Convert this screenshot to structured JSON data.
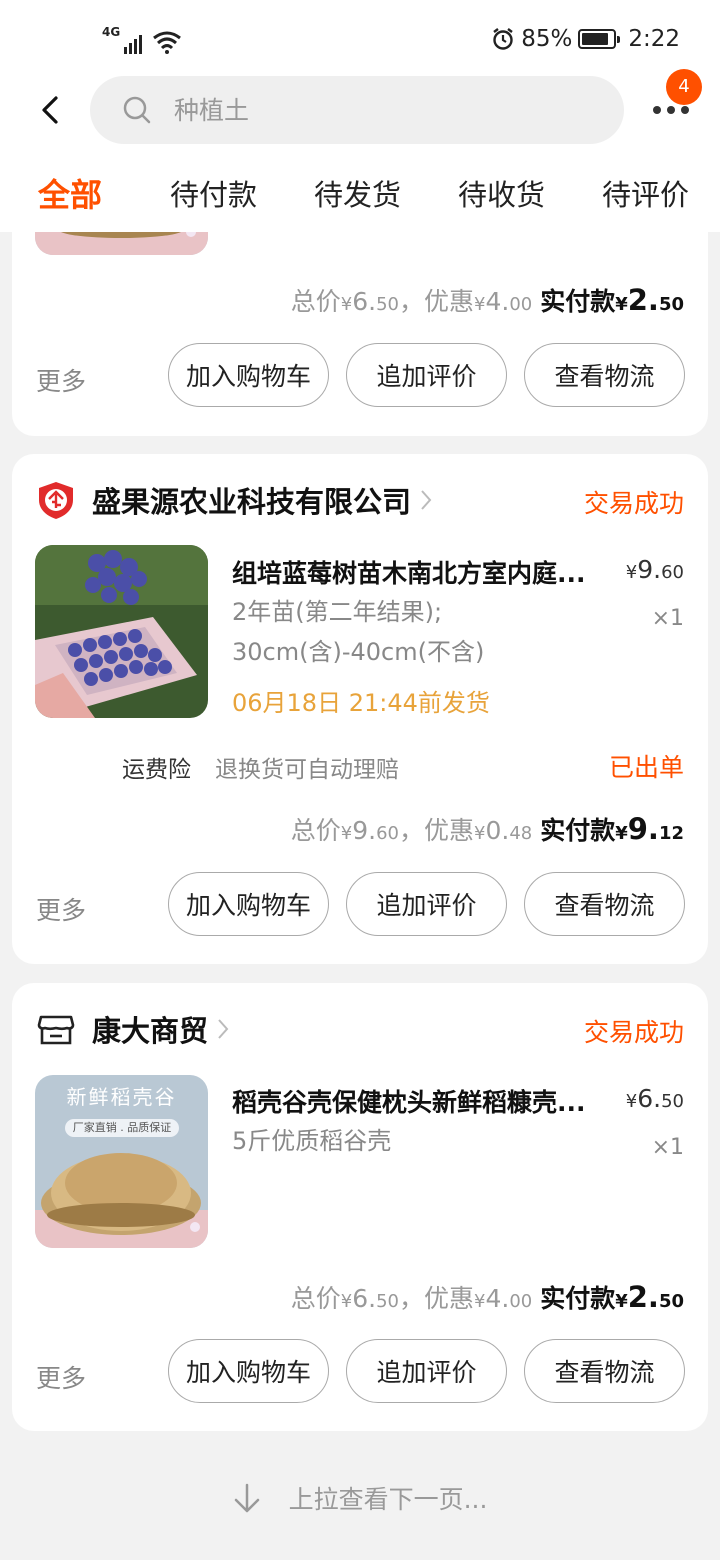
{
  "status_bar": {
    "network": "4G",
    "battery": "85%",
    "battery_level": 0.85,
    "time": "2:22"
  },
  "search": {
    "placeholder": "种植土",
    "badge_count": "4"
  },
  "tabs": [
    {
      "label": "全部",
      "active": true
    },
    {
      "label": "待付款",
      "active": false
    },
    {
      "label": "待发货",
      "active": false
    },
    {
      "label": "待收货",
      "active": false
    },
    {
      "label": "待评价",
      "active": false
    }
  ],
  "orders": [
    {
      "summary": {
        "total_label": "总价",
        "total_int": "6.",
        "total_dec": "50",
        "discount_label": "优惠",
        "discount_int": "4.",
        "discount_dec": "00",
        "paid_label": "实付款",
        "paid_int": "2.",
        "paid_dec": "50"
      },
      "actions": {
        "more": "更多",
        "add_cart": "加入购物车",
        "review": "追加评价",
        "logistics": "查看物流"
      }
    },
    {
      "shop": "盛果源农业科技有限公司",
      "shop_icon": "enterprise-shield-icon",
      "status": "交易成功",
      "item": {
        "title": "组培蓝莓树苗木南北方室内庭...",
        "price_int": "9.",
        "price_dec": "60",
        "sku_line1": "2年苗(第二年结果);",
        "sku_line2": "30cm(含)-40cm(不含)",
        "qty": "×1",
        "ship_time": "06月18日 21:44前发货"
      },
      "insurance": {
        "label": "运费险",
        "desc": "退换货可自动理赔",
        "status": "已出单"
      },
      "summary": {
        "total_label": "总价",
        "total_int": "9.",
        "total_dec": "60",
        "discount_label": "优惠",
        "discount_int": "0.",
        "discount_dec": "48",
        "paid_label": "实付款",
        "paid_int": "9.",
        "paid_dec": "12"
      },
      "actions": {
        "more": "更多",
        "add_cart": "加入购物车",
        "review": "追加评价",
        "logistics": "查看物流"
      }
    },
    {
      "shop": "康大商贸",
      "shop_icon": "store-icon",
      "status": "交易成功",
      "item": {
        "title": "稻壳谷壳保健枕头新鲜稻糠壳...",
        "price_int": "6.",
        "price_dec": "50",
        "sku_line1": "5斤优质稻谷壳",
        "qty": "×1",
        "image_text": "新鲜稻壳谷",
        "image_banner": "厂家直销 . 品质保证"
      },
      "summary": {
        "total_label": "总价",
        "total_int": "6.",
        "total_dec": "50",
        "discount_label": "优惠",
        "discount_int": "4.",
        "discount_dec": "00",
        "paid_label": "实付款",
        "paid_int": "2.",
        "paid_dec": "50"
      },
      "actions": {
        "more": "更多",
        "add_cart": "加入购物车",
        "review": "追加评价",
        "logistics": "查看物流"
      }
    }
  ],
  "footer": {
    "hint": "上拉查看下一页..."
  },
  "colors": {
    "accent": "#ff5000",
    "ship_time": "#e8a33a",
    "page_bg": "#f2f2f2"
  }
}
